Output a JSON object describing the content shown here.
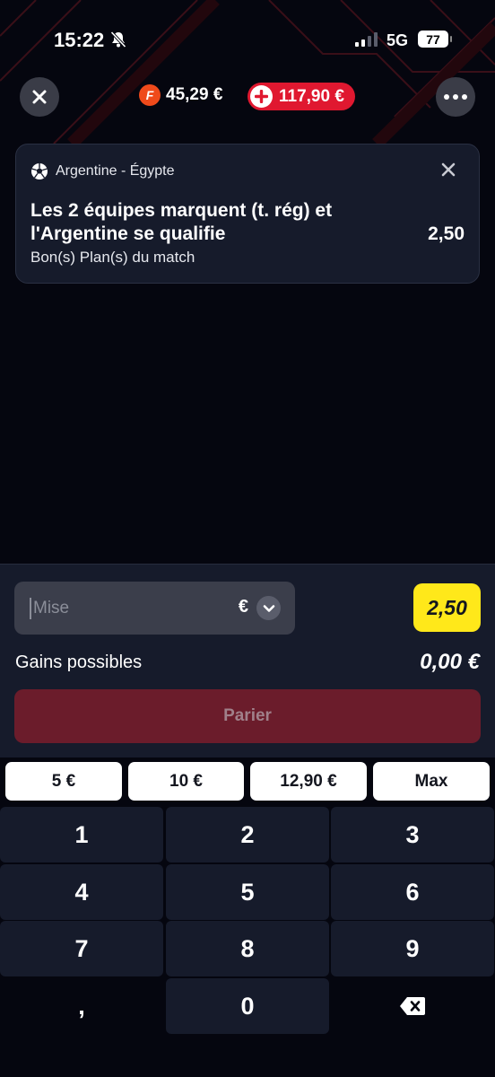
{
  "status": {
    "time": "15:22",
    "network": "5G",
    "battery": "77"
  },
  "header": {
    "balance": "45,29 €",
    "bonus": "117,90 €",
    "brand_letter": "F"
  },
  "bet": {
    "match": "Argentine - Égypte",
    "selection": "Les 2 équipes marquent (t. rég) et l'Argentine se qualifie",
    "odd": "2,50",
    "market": "Bon(s) Plan(s) du match"
  },
  "slip": {
    "stake_placeholder": "Mise",
    "currency": "€",
    "total_odd": "2,50",
    "gains_label": "Gains possibles",
    "gains_value": "0,00 €",
    "place_bet": "Parier"
  },
  "quick_amounts": [
    "5 €",
    "10 €",
    "12,90 €",
    "Max"
  ],
  "keypad": [
    "1",
    "2",
    "3",
    "4",
    "5",
    "6",
    "7",
    "8",
    "9",
    ",",
    "0"
  ],
  "colors": {
    "accent_red": "#e01830",
    "odd_yellow": "#ffe81a",
    "panel": "#161b2b"
  }
}
